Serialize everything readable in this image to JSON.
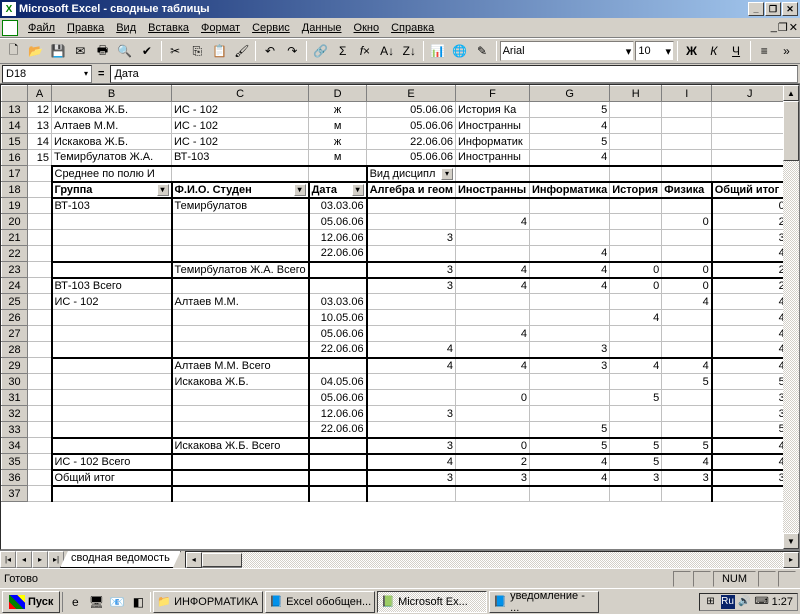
{
  "title": "Microsoft Excel - сводные таблицы",
  "menu": [
    "Файл",
    "Правка",
    "Вид",
    "Вставка",
    "Формат",
    "Сервис",
    "Данные",
    "Окно",
    "Справка"
  ],
  "font": {
    "name": "Arial",
    "size": "10"
  },
  "namebox": "D18",
  "formula": "Дата",
  "cols": [
    "A",
    "B",
    "C",
    "D",
    "E",
    "F",
    "G",
    "H",
    "I",
    "J"
  ],
  "top_rows": [
    {
      "n": "13",
      "A": "12",
      "B": "Искакова Ж.Б.",
      "C": "ИС - 102",
      "D": "ж",
      "E": "05.06.06",
      "F": "История Ка",
      "G": "5"
    },
    {
      "n": "14",
      "A": "13",
      "B": "Алтаев М.М.",
      "C": "ИС - 102",
      "D": "м",
      "E": "05.06.06",
      "F": "Иностранны",
      "G": "4"
    },
    {
      "n": "15",
      "A": "14",
      "B": "Искакова Ж.Б.",
      "C": "ИС - 102",
      "D": "ж",
      "E": "22.06.06",
      "F": "Информатик",
      "G": "5"
    },
    {
      "n": "16",
      "A": "15",
      "B": "Темирбулатов Ж.А.",
      "C": "ВТ-103",
      "D": "м",
      "E": "05.06.06",
      "F": "Иностранны",
      "G": "4"
    }
  ],
  "row17": {
    "B": "Среднее по полю И",
    "E": "Вид дисципл"
  },
  "row18": {
    "B": "Группа",
    "C": "Ф.И.О. Студен",
    "D": "Дата",
    "E": "Алгебра и геом",
    "F": "Иностранны",
    "G": "Информатика",
    "H": "История",
    "I": "Физика",
    "J": "Общий итог"
  },
  "data_rows": [
    {
      "n": "19",
      "B": "ВТ-103",
      "C": "Темирбулатов",
      "D": "03.03.06",
      "J": "0"
    },
    {
      "n": "20",
      "D": "05.06.06",
      "F": "4",
      "I": "0",
      "J": "2"
    },
    {
      "n": "21",
      "D": "12.06.06",
      "E": "3",
      "J": "3"
    },
    {
      "n": "22",
      "D": "22.06.06",
      "G": "4",
      "J": "4"
    },
    {
      "n": "23",
      "C": "Темирбулатов Ж.А. Всего",
      "E": "3",
      "F": "4",
      "G": "4",
      "H": "0",
      "I": "0",
      "J": "2"
    },
    {
      "n": "24",
      "B": "ВТ-103 Всего",
      "E": "3",
      "F": "4",
      "G": "4",
      "H": "0",
      "I": "0",
      "J": "2"
    },
    {
      "n": "25",
      "B": "ИС - 102",
      "C": "Алтаев М.М.",
      "D": "03.03.06",
      "I": "4",
      "J": "4"
    },
    {
      "n": "26",
      "D": "10.05.06",
      "H": "4",
      "J": "4"
    },
    {
      "n": "27",
      "D": "05.06.06",
      "F": "4",
      "J": "4"
    },
    {
      "n": "28",
      "D": "22.06.06",
      "E": "4",
      "G": "3",
      "J": "4"
    },
    {
      "n": "29",
      "C": "Алтаев М.М. Всего",
      "E": "4",
      "F": "4",
      "G": "3",
      "H": "4",
      "I": "4",
      "J": "4"
    },
    {
      "n": "30",
      "C": "Искакова Ж.Б.",
      "D": "04.05.06",
      "I": "5",
      "J": "5"
    },
    {
      "n": "31",
      "D": "05.06.06",
      "F": "0",
      "H": "5",
      "J": "3"
    },
    {
      "n": "32",
      "D": "12.06.06",
      "E": "3",
      "J": "3"
    },
    {
      "n": "33",
      "D": "22.06.06",
      "G": "5",
      "J": "5"
    },
    {
      "n": "34",
      "C": "Искакова Ж.Б. Всего",
      "E": "3",
      "F": "0",
      "G": "5",
      "H": "5",
      "I": "5",
      "J": "4"
    },
    {
      "n": "35",
      "B": "ИС - 102 Всего",
      "E": "4",
      "F": "2",
      "G": "4",
      "H": "5",
      "I": "4",
      "J": "4"
    },
    {
      "n": "36",
      "B": "Общий итог",
      "E": "3",
      "F": "3",
      "G": "4",
      "H": "3",
      "I": "3",
      "J": "3"
    },
    {
      "n": "37"
    }
  ],
  "sheet_tab": "сводная ведомость",
  "status": "Готово",
  "status_num": "NUM",
  "taskbar": {
    "start": "Пуск",
    "items": [
      {
        "icon": "📁",
        "label": "ИНФОРМАТИКА"
      },
      {
        "icon": "📘",
        "label": "Excel обобщен..."
      },
      {
        "icon": "📗",
        "label": "Microsoft Ex...",
        "active": true
      },
      {
        "icon": "📘",
        "label": "уведомление - ..."
      }
    ],
    "tray": {
      "lang": "Ru",
      "time": "1:27"
    }
  }
}
